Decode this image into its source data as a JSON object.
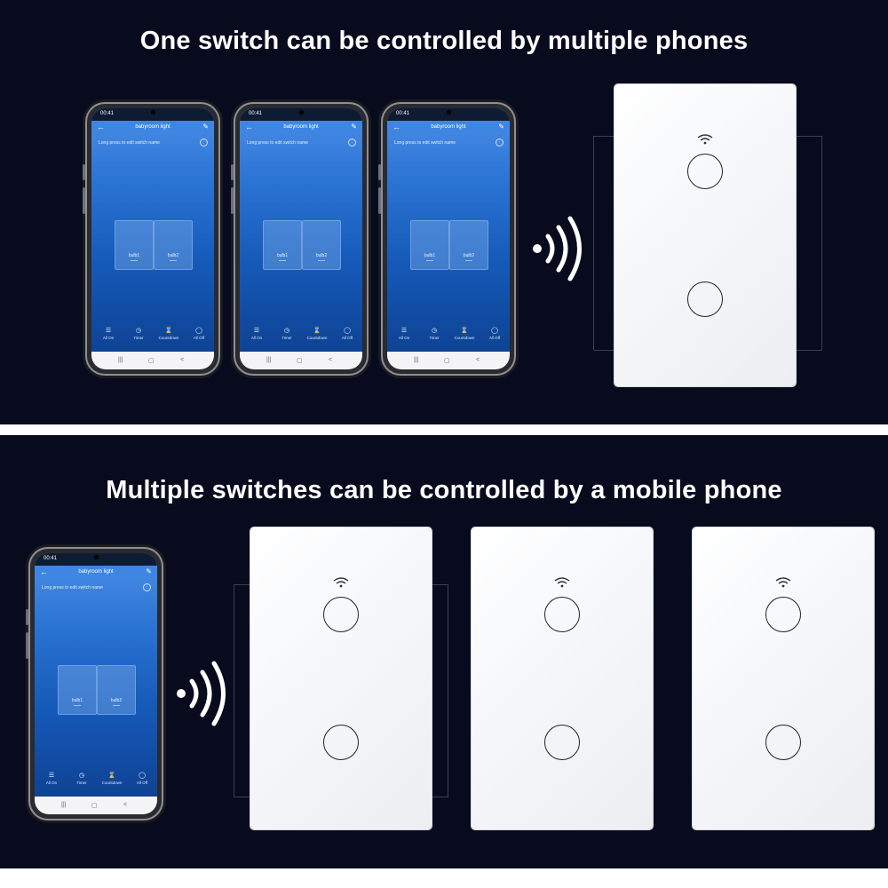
{
  "top_panel": {
    "headline": "One switch can be controlled by multiple phones"
  },
  "bottom_panel": {
    "headline": "Multiple switches can be controlled by a mobile phone"
  },
  "phone_app": {
    "time": "00:41",
    "title": "babyroom light",
    "hint": "Long press to edit switch name",
    "gangs": [
      "bulb1",
      "bulb2"
    ],
    "tools": [
      {
        "icon": "all-on-icon",
        "label": "All On"
      },
      {
        "icon": "timer-icon",
        "label": "Timer"
      },
      {
        "icon": "countdown-icon",
        "label": "Countdown"
      },
      {
        "icon": "all-off-icon",
        "label": "All Off"
      }
    ]
  },
  "colors": {
    "background": "#070b1d",
    "headline": "#ffffff",
    "screen_top": "#4d8ee6",
    "screen_bottom": "#0d3e8c",
    "switch_face": "#f4f6f9"
  }
}
